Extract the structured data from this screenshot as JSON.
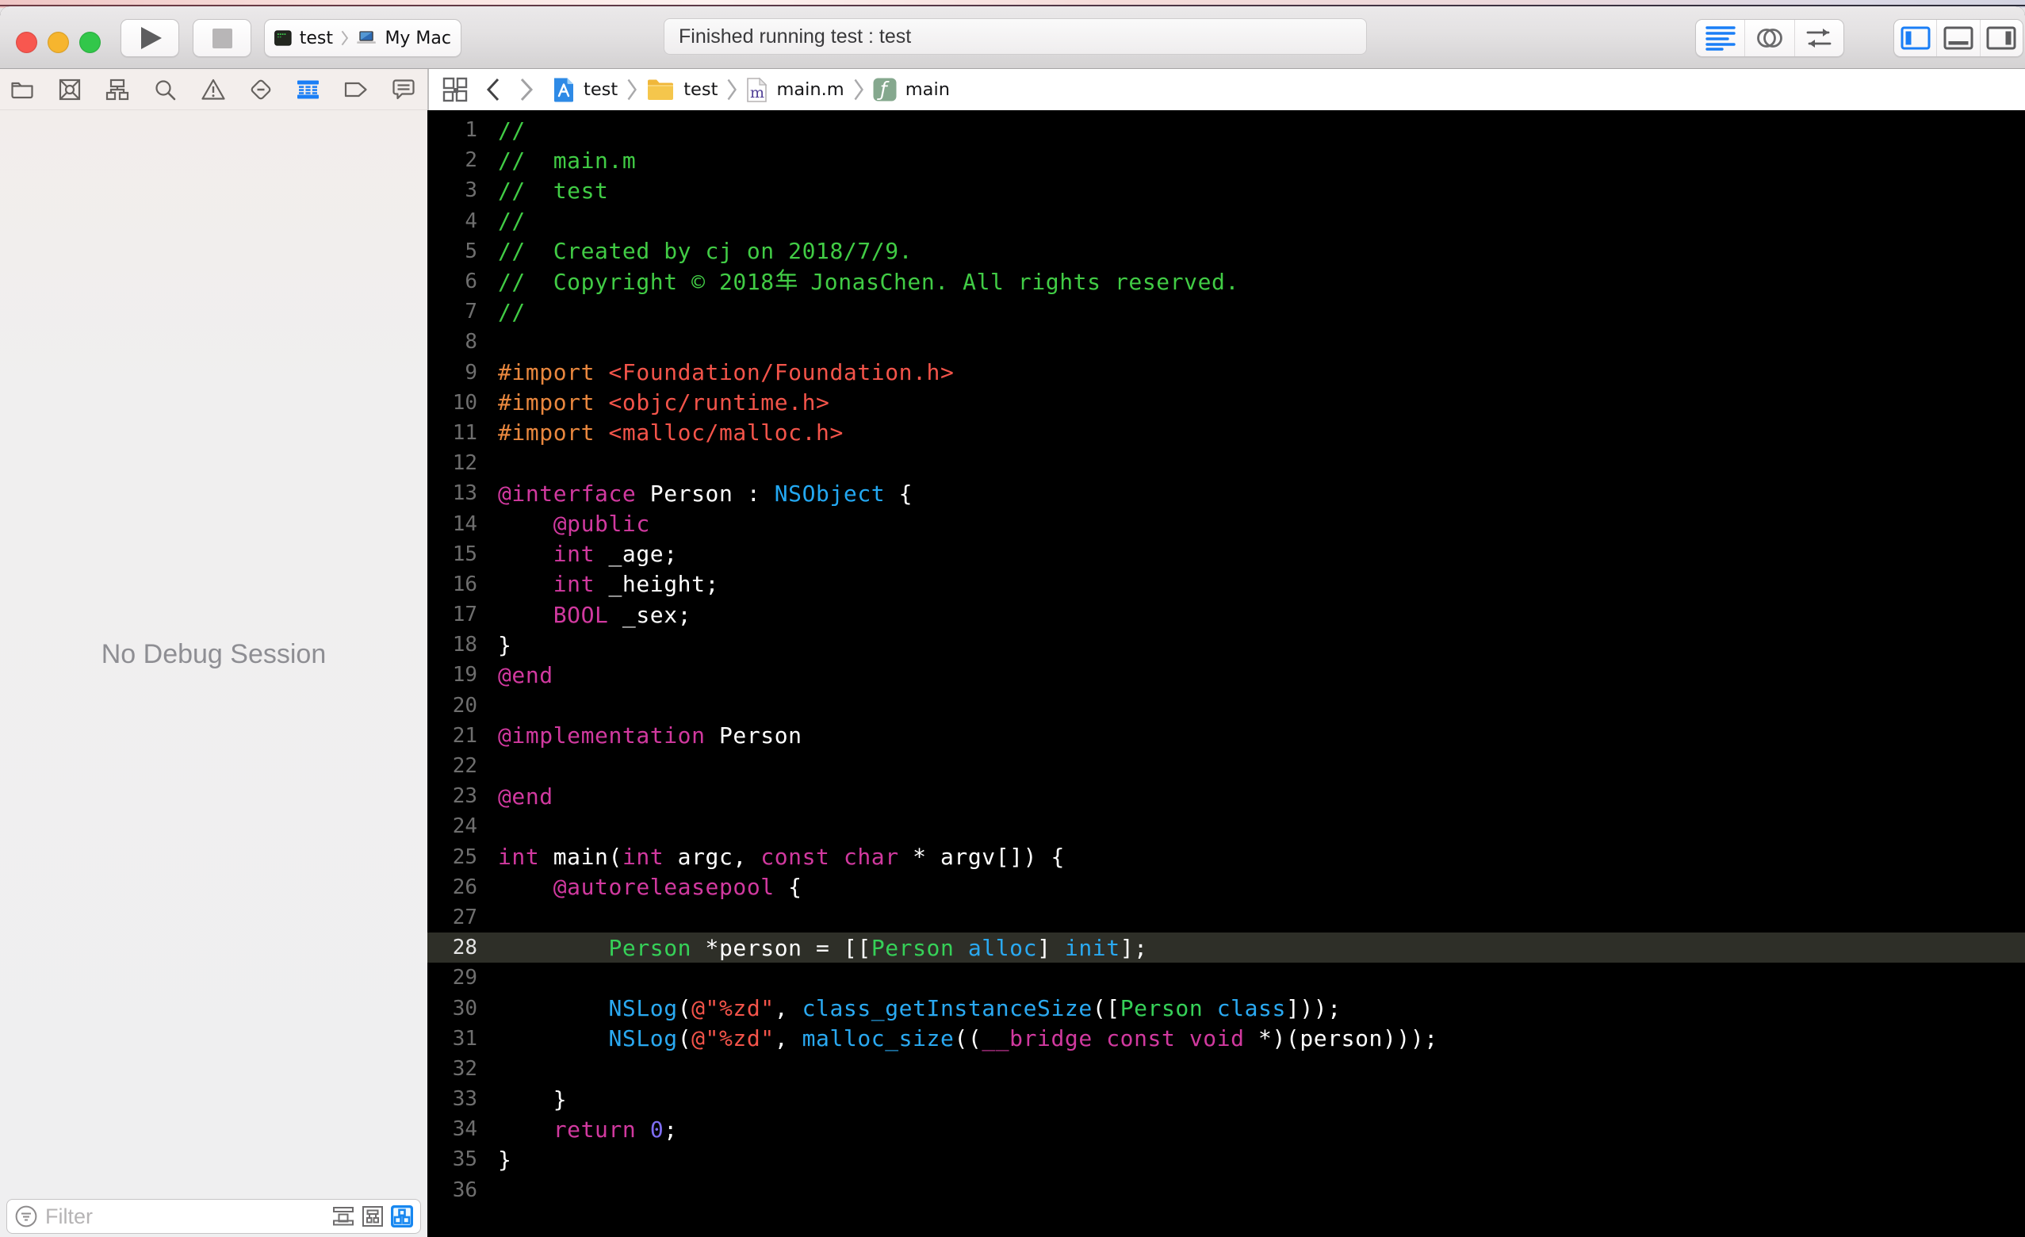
{
  "ui_colors": {
    "accent_blue": "#1787f0",
    "traffic_red": "#f8574f",
    "traffic_yellow": "#f6b52e",
    "traffic_green": "#32c74a"
  },
  "toolbar": {
    "scheme": {
      "target": "test",
      "destination": "My Mac"
    },
    "status_text": "Finished running test : test"
  },
  "navigator_bar": {
    "items": [
      {
        "name": "project-navigator",
        "active": false
      },
      {
        "name": "source-control-navigator",
        "active": false
      },
      {
        "name": "symbol-navigator",
        "active": false
      },
      {
        "name": "find-navigator",
        "active": false
      },
      {
        "name": "issue-navigator",
        "active": false
      },
      {
        "name": "test-navigator",
        "active": false
      },
      {
        "name": "debug-navigator",
        "active": true
      },
      {
        "name": "breakpoint-navigator",
        "active": false
      },
      {
        "name": "report-navigator",
        "active": false
      }
    ]
  },
  "jump_bar": {
    "crumbs": [
      {
        "icon": "project",
        "label": "test"
      },
      {
        "icon": "folder",
        "label": "test"
      },
      {
        "icon": "objc-file",
        "label": "main.m"
      },
      {
        "icon": "function",
        "label": "main"
      }
    ]
  },
  "debug_area": {
    "empty_message": "No Debug Session",
    "filter_placeholder": "Filter"
  },
  "editor": {
    "highlighted_line": 28,
    "palette": {
      "plain": "#ffffff",
      "comment": "#41cc45",
      "preprocessor": "#e9873e",
      "string": "#f4544a",
      "keyword": "#d1399f",
      "framework_class": "#23a8f2",
      "project_class": "#36d158",
      "method": "#2aa9f1",
      "number": "#7e6df2",
      "line_number": "#6e6e6e",
      "highlight_row": "#2e2f28",
      "background": "#000000"
    },
    "lines": [
      [
        [
          "c",
          "//"
        ]
      ],
      [
        [
          "c",
          "//  main.m"
        ]
      ],
      [
        [
          "c",
          "//  test"
        ]
      ],
      [
        [
          "c",
          "//"
        ]
      ],
      [
        [
          "c",
          "//  Created by cj on 2018/7/9."
        ]
      ],
      [
        [
          "c",
          "//  Copyright © 2018年 JonasChen. All rights reserved."
        ]
      ],
      [
        [
          "c",
          "//"
        ]
      ],
      [],
      [
        [
          "pre",
          "#import"
        ],
        [
          "p",
          " "
        ],
        [
          "s",
          "<Foundation/Foundation.h>"
        ]
      ],
      [
        [
          "pre",
          "#import"
        ],
        [
          "p",
          " "
        ],
        [
          "s",
          "<objc/runtime.h>"
        ]
      ],
      [
        [
          "pre",
          "#import"
        ],
        [
          "p",
          " "
        ],
        [
          "s",
          "<malloc/malloc.h>"
        ]
      ],
      [],
      [
        [
          "k",
          "@interface"
        ],
        [
          "p",
          " Person : "
        ],
        [
          "cls",
          "NSObject"
        ],
        [
          "p",
          " {"
        ]
      ],
      [
        [
          "p",
          "    "
        ],
        [
          "k",
          "@public"
        ]
      ],
      [
        [
          "p",
          "    "
        ],
        [
          "k",
          "int"
        ],
        [
          "p",
          " _age;"
        ]
      ],
      [
        [
          "p",
          "    "
        ],
        [
          "k",
          "int"
        ],
        [
          "p",
          " _height;"
        ]
      ],
      [
        [
          "p",
          "    "
        ],
        [
          "k",
          "BOOL"
        ],
        [
          "p",
          " _sex;"
        ]
      ],
      [
        [
          "p",
          "}"
        ]
      ],
      [
        [
          "k",
          "@end"
        ]
      ],
      [],
      [
        [
          "k",
          "@implementation"
        ],
        [
          "p",
          " Person"
        ]
      ],
      [],
      [
        [
          "k",
          "@end"
        ]
      ],
      [],
      [
        [
          "k",
          "int"
        ],
        [
          "p",
          " main("
        ],
        [
          "k",
          "int"
        ],
        [
          "p",
          " argc, "
        ],
        [
          "k",
          "const"
        ],
        [
          "p",
          " "
        ],
        [
          "k",
          "char"
        ],
        [
          "p",
          " * argv[]) {"
        ]
      ],
      [
        [
          "p",
          "    "
        ],
        [
          "k",
          "@autoreleasepool"
        ],
        [
          "p",
          " {"
        ]
      ],
      [],
      [
        [
          "p",
          "        "
        ],
        [
          "pc",
          "Person"
        ],
        [
          "p",
          " *person = [["
        ],
        [
          "pc",
          "Person"
        ],
        [
          "p",
          " "
        ],
        [
          "m",
          "alloc"
        ],
        [
          "p",
          "] "
        ],
        [
          "m",
          "init"
        ],
        [
          "p",
          "];"
        ]
      ],
      [],
      [
        [
          "p",
          "        "
        ],
        [
          "m",
          "NSLog"
        ],
        [
          "p",
          "("
        ],
        [
          "s",
          "@\"%zd\""
        ],
        [
          "p",
          ", "
        ],
        [
          "m",
          "class_getInstanceSize"
        ],
        [
          "p",
          "(["
        ],
        [
          "pc",
          "Person"
        ],
        [
          "p",
          " "
        ],
        [
          "m",
          "class"
        ],
        [
          "p",
          "]));"
        ]
      ],
      [
        [
          "p",
          "        "
        ],
        [
          "m",
          "NSLog"
        ],
        [
          "p",
          "("
        ],
        [
          "s",
          "@\"%zd\""
        ],
        [
          "p",
          ", "
        ],
        [
          "m",
          "malloc_size"
        ],
        [
          "p",
          "(("
        ],
        [
          "k",
          "__bridge"
        ],
        [
          "p",
          " "
        ],
        [
          "k",
          "const"
        ],
        [
          "p",
          " "
        ],
        [
          "k",
          "void"
        ],
        [
          "p",
          " *)(person)));"
        ]
      ],
      [],
      [
        [
          "p",
          "    }"
        ]
      ],
      [
        [
          "p",
          "    "
        ],
        [
          "k",
          "return"
        ],
        [
          "p",
          " "
        ],
        [
          "n",
          "0"
        ],
        [
          "p",
          ";"
        ]
      ],
      [
        [
          "p",
          "}"
        ]
      ],
      []
    ]
  }
}
